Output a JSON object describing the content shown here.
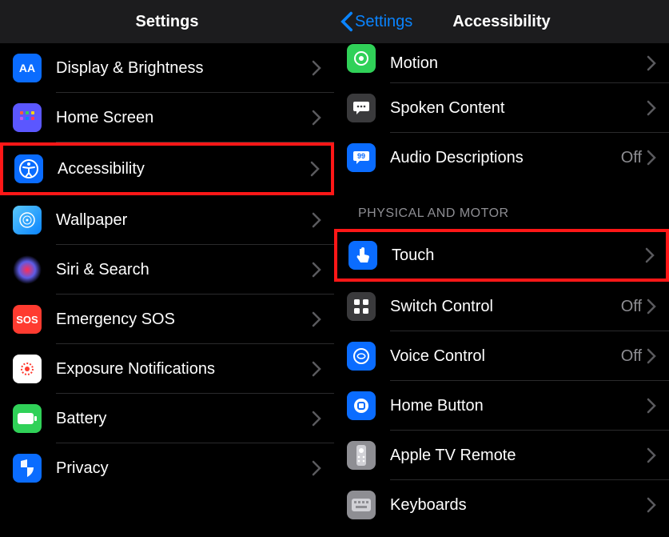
{
  "left": {
    "title": "Settings",
    "items": [
      {
        "label": "Display & Brightness",
        "value": "",
        "highlight": false,
        "icon": "display-brightness-icon"
      },
      {
        "label": "Home Screen",
        "value": "",
        "highlight": false,
        "icon": "home-screen-icon"
      },
      {
        "label": "Accessibility",
        "value": "",
        "highlight": true,
        "icon": "accessibility-icon"
      },
      {
        "label": "Wallpaper",
        "value": "",
        "highlight": false,
        "icon": "wallpaper-icon"
      },
      {
        "label": "Siri & Search",
        "value": "",
        "highlight": false,
        "icon": "siri-icon"
      },
      {
        "label": "Emergency SOS",
        "value": "",
        "highlight": false,
        "icon": "sos-icon"
      },
      {
        "label": "Exposure Notifications",
        "value": "",
        "highlight": false,
        "icon": "exposure-icon"
      },
      {
        "label": "Battery",
        "value": "",
        "highlight": false,
        "icon": "battery-icon"
      },
      {
        "label": "Privacy",
        "value": "",
        "highlight": false,
        "icon": "privacy-icon"
      }
    ]
  },
  "right": {
    "back": "Settings",
    "title": "Accessibility",
    "top_items": [
      {
        "label": "Motion",
        "value": "",
        "highlight": false,
        "icon": "motion-icon"
      },
      {
        "label": "Spoken Content",
        "value": "",
        "highlight": false,
        "icon": "spoken-content-icon"
      },
      {
        "label": "Audio Descriptions",
        "value": "Off",
        "highlight": false,
        "icon": "audio-descriptions-icon"
      }
    ],
    "section": "PHYSICAL AND MOTOR",
    "items": [
      {
        "label": "Touch",
        "value": "",
        "highlight": true,
        "icon": "touch-icon"
      },
      {
        "label": "Switch Control",
        "value": "Off",
        "highlight": false,
        "icon": "switch-control-icon"
      },
      {
        "label": "Voice Control",
        "value": "Off",
        "highlight": false,
        "icon": "voice-control-icon"
      },
      {
        "label": "Home Button",
        "value": "",
        "highlight": false,
        "icon": "home-button-icon"
      },
      {
        "label": "Apple TV Remote",
        "value": "",
        "highlight": false,
        "icon": "apple-tv-remote-icon"
      },
      {
        "label": "Keyboards",
        "value": "",
        "highlight": false,
        "icon": "keyboards-icon"
      }
    ]
  }
}
